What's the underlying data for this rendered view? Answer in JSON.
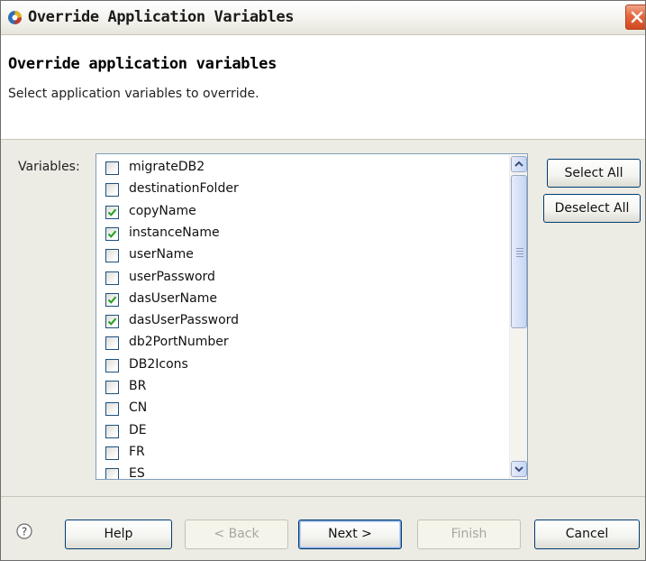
{
  "window": {
    "title": "Override Application Variables",
    "accent_color": "#e4673d"
  },
  "header": {
    "title": "Override application variables",
    "description": "Select application variables to override."
  },
  "variables": {
    "label": "Variables:",
    "items": [
      {
        "label": "migrateDB2",
        "checked": false
      },
      {
        "label": "destinationFolder",
        "checked": false
      },
      {
        "label": "copyName",
        "checked": true
      },
      {
        "label": "instanceName",
        "checked": true
      },
      {
        "label": "userName",
        "checked": false
      },
      {
        "label": "userPassword",
        "checked": false
      },
      {
        "label": "dasUserName",
        "checked": true
      },
      {
        "label": "dasUserPassword",
        "checked": true
      },
      {
        "label": "db2PortNumber",
        "checked": false
      },
      {
        "label": "DB2Icons",
        "checked": false
      },
      {
        "label": "BR",
        "checked": false
      },
      {
        "label": "CN",
        "checked": false
      },
      {
        "label": "DE",
        "checked": false
      },
      {
        "label": "FR",
        "checked": false
      },
      {
        "label": "ES",
        "checked": false
      }
    ],
    "select_all_label": "Select All",
    "deselect_all_label": "Deselect All"
  },
  "footer": {
    "help_label": "Help",
    "back_label": "< Back",
    "next_label": "Next >",
    "finish_label": "Finish",
    "cancel_label": "Cancel"
  }
}
